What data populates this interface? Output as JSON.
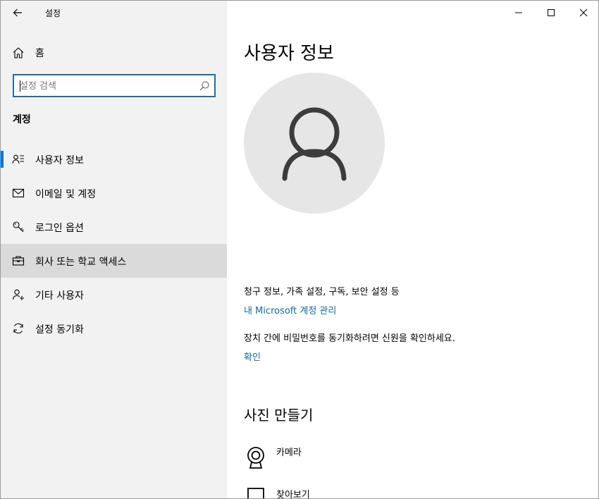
{
  "app": {
    "title": "설정"
  },
  "sidebar": {
    "home_label": "홈",
    "search": {
      "placeholder": "설정 검색",
      "value": ""
    },
    "section_title": "계정",
    "items": [
      {
        "label": "사용자 정보",
        "icon": "user-info-icon",
        "selected": true
      },
      {
        "label": "이메일 및 계정",
        "icon": "mail-icon",
        "selected": false
      },
      {
        "label": "로그인 옵션",
        "icon": "key-icon",
        "selected": false
      },
      {
        "label": "회사 또는 학교 액세스",
        "icon": "briefcase-icon",
        "selected": false,
        "hovered": true
      },
      {
        "label": "기타 사용자",
        "icon": "add-user-icon",
        "selected": false
      },
      {
        "label": "설정 동기화",
        "icon": "sync-icon",
        "selected": false
      }
    ]
  },
  "main": {
    "title": "사용자 정보",
    "billing_text": "청구 정보, 가족 설정, 구독, 보안 설정 등",
    "manage_link": "내 Microsoft 계정 관리",
    "verify_text": "장치 간에 비밀번호를 동기화하려면 신원을 확인하세요.",
    "verify_link": "확인",
    "create_photo_title": "사진 만들기",
    "photo_options": [
      {
        "label": "카메라",
        "icon": "camera-icon"
      },
      {
        "label": "찾아보기",
        "icon": "browse-icon"
      }
    ]
  },
  "colors": {
    "accent": "#0078d7",
    "link": "#0e6a9c",
    "sidebar_bg": "#f2f2f2",
    "hover_bg": "#dadada",
    "avatar_bg": "#e6e6e6",
    "avatar_fg": "#3c3c3c"
  }
}
